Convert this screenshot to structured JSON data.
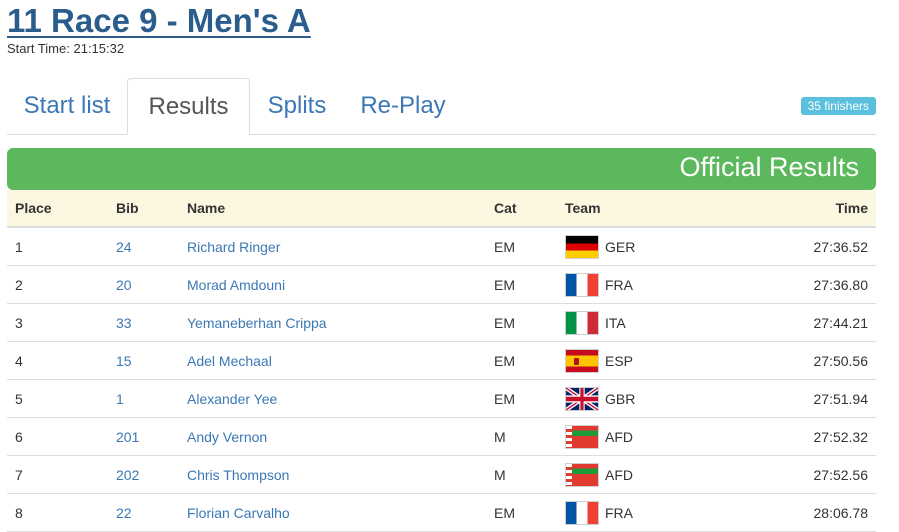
{
  "race": {
    "title": "11 Race 9 - Men's A",
    "start_time_label": "Start Time:",
    "start_time": "21:15:32"
  },
  "tabs": [
    {
      "label": "Start list",
      "active": false
    },
    {
      "label": "Results",
      "active": true
    },
    {
      "label": "Splits",
      "active": false
    },
    {
      "label": "Re-Play",
      "active": false
    }
  ],
  "finishers_badge": "35 finishers",
  "panel": {
    "title": "Official Results",
    "color": "#5cb85c"
  },
  "table": {
    "headers": {
      "place": "Place",
      "bib": "Bib",
      "name": "Name",
      "cat": "Cat",
      "team": "Team",
      "time": "Time"
    },
    "rows": [
      {
        "place": "1",
        "bib": "24",
        "name": "Richard Ringer",
        "cat": "EM",
        "team": "GER",
        "flag": "ger-flag-icon",
        "time": "27:36.52"
      },
      {
        "place": "2",
        "bib": "20",
        "name": "Morad Amdouni",
        "cat": "EM",
        "team": "FRA",
        "flag": "fra-flag-icon",
        "time": "27:36.80"
      },
      {
        "place": "3",
        "bib": "33",
        "name": "Yemaneberhan Crippa",
        "cat": "EM",
        "team": "ITA",
        "flag": "ita-flag-icon",
        "time": "27:44.21"
      },
      {
        "place": "4",
        "bib": "15",
        "name": "Adel Mechaal",
        "cat": "EM",
        "team": "ESP",
        "flag": "esp-flag-icon",
        "time": "27:50.56"
      },
      {
        "place": "5",
        "bib": "1",
        "name": "Alexander Yee",
        "cat": "EM",
        "team": "GBR",
        "flag": "gbr-flag-icon",
        "time": "27:51.94"
      },
      {
        "place": "6",
        "bib": "201",
        "name": "Andy Vernon",
        "cat": "M",
        "team": "AFD",
        "flag": "afd-flag-icon",
        "time": "27:52.32"
      },
      {
        "place": "7",
        "bib": "202",
        "name": "Chris Thompson",
        "cat": "M",
        "team": "AFD",
        "flag": "afd-flag-icon",
        "time": "27:52.56"
      },
      {
        "place": "8",
        "bib": "22",
        "name": "Florian Carvalho",
        "cat": "EM",
        "team": "FRA",
        "flag": "fra-flag-icon",
        "time": "28:06.78"
      }
    ]
  },
  "colors": {
    "link": "#3b78b5",
    "title": "#2a5d8c",
    "header_row": "#fcf7e1",
    "badge": "#5bc0de"
  }
}
